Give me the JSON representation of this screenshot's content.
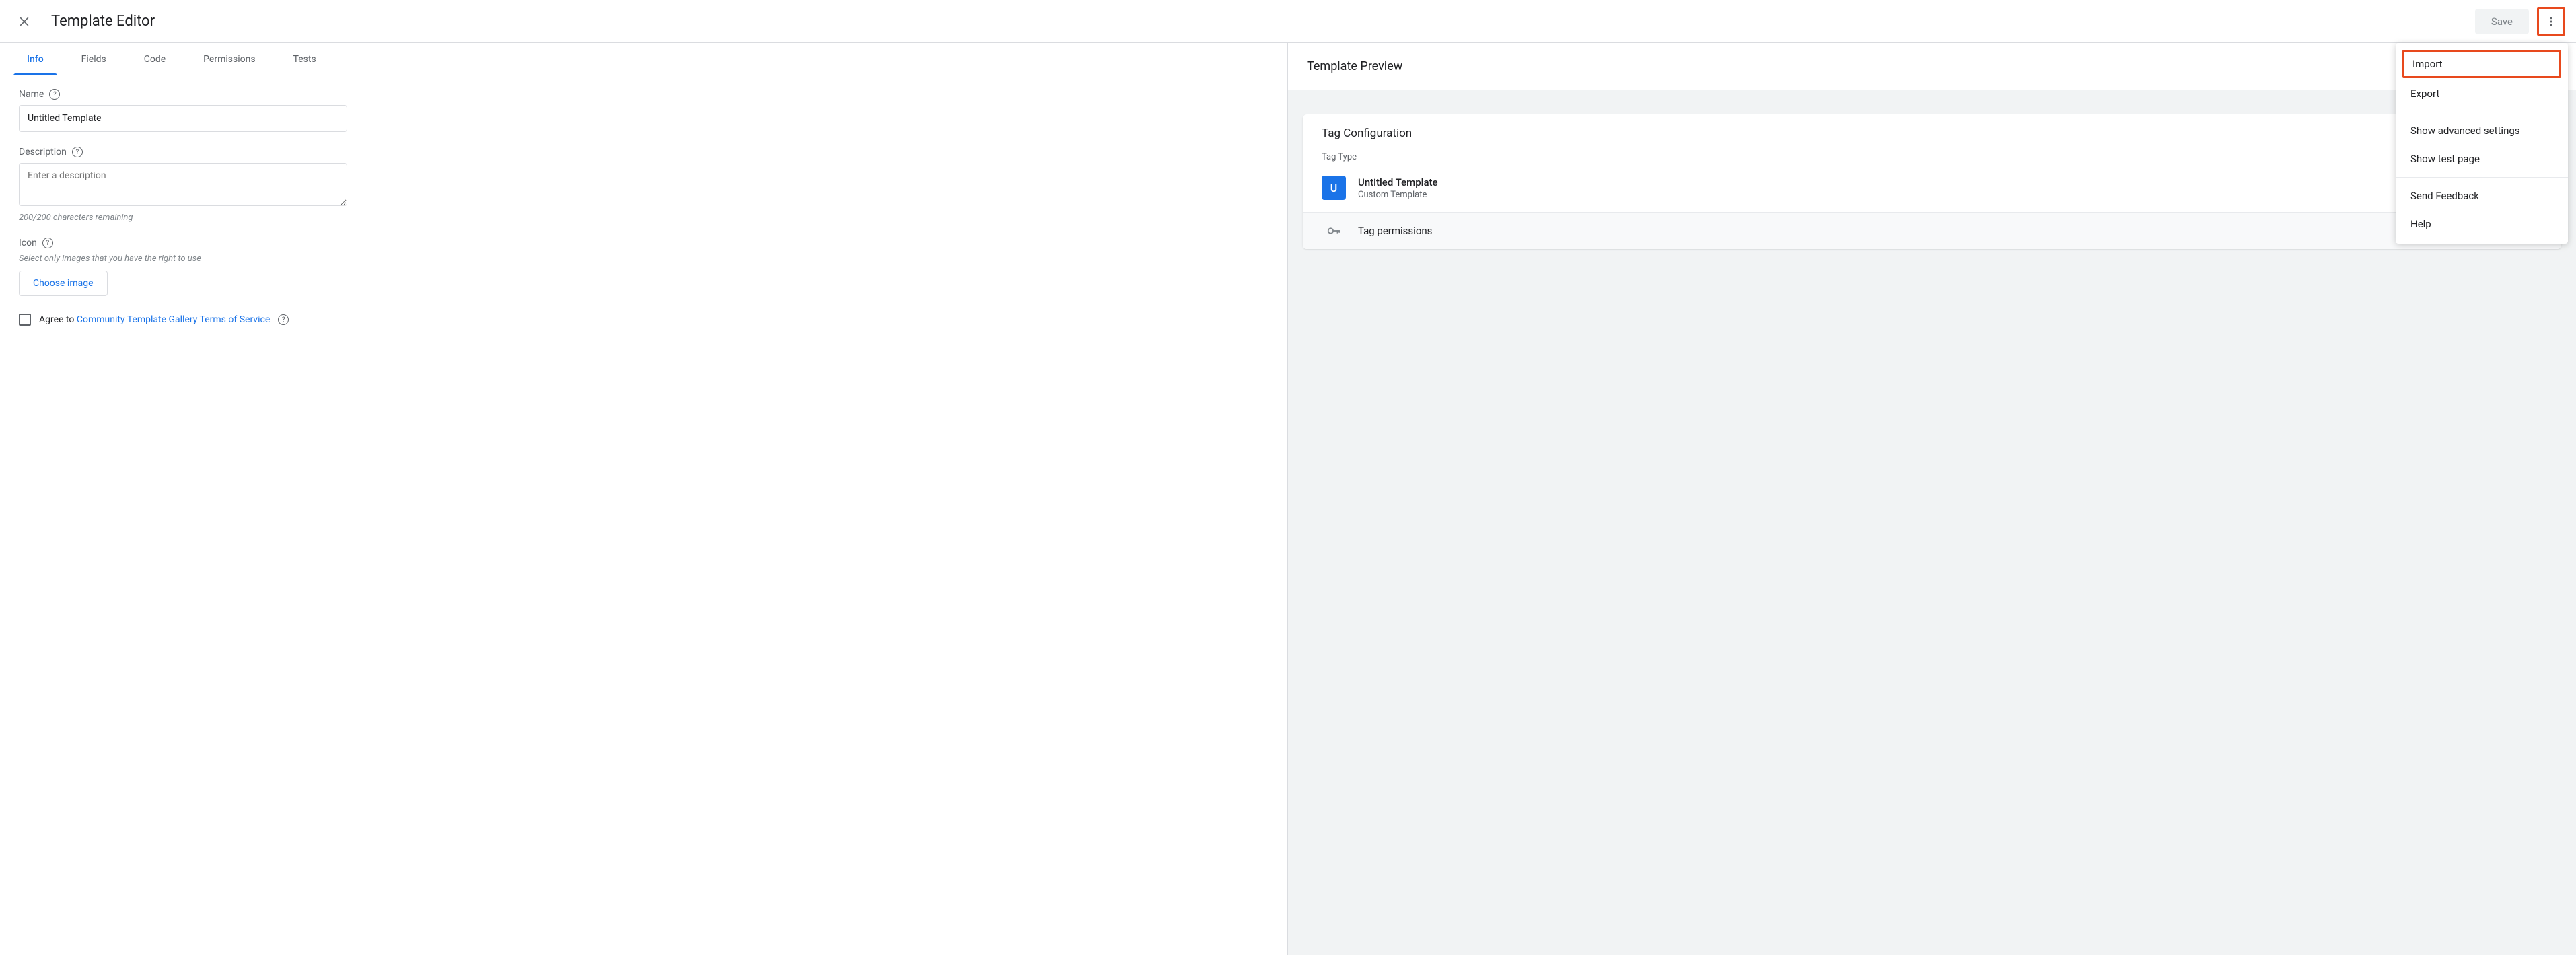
{
  "header": {
    "title": "Template Editor",
    "save_label": "Save"
  },
  "tabs": [
    "Info",
    "Fields",
    "Code",
    "Permissions",
    "Tests"
  ],
  "form": {
    "name_label": "Name",
    "name_value": "Untitled Template",
    "desc_label": "Description",
    "desc_placeholder": "Enter a description",
    "desc_hint": "200/200 characters remaining",
    "icon_label": "Icon",
    "icon_hint": "Select only images that you have the right to use",
    "choose_label": "Choose image",
    "agree_prefix": "Agree to ",
    "agree_link": "Community Template Gallery Terms of Service"
  },
  "preview": {
    "title": "Template Preview",
    "card_title": "Tag Configuration",
    "tag_type_label": "Tag Type",
    "tag_letter": "U",
    "tag_name": "Untitled Template",
    "tag_sub": "Custom Template",
    "perm_label": "Tag permissions"
  },
  "menu": {
    "import": "Import",
    "export": "Export",
    "advanced": "Show advanced settings",
    "testpage": "Show test page",
    "feedback": "Send Feedback",
    "help": "Help"
  }
}
